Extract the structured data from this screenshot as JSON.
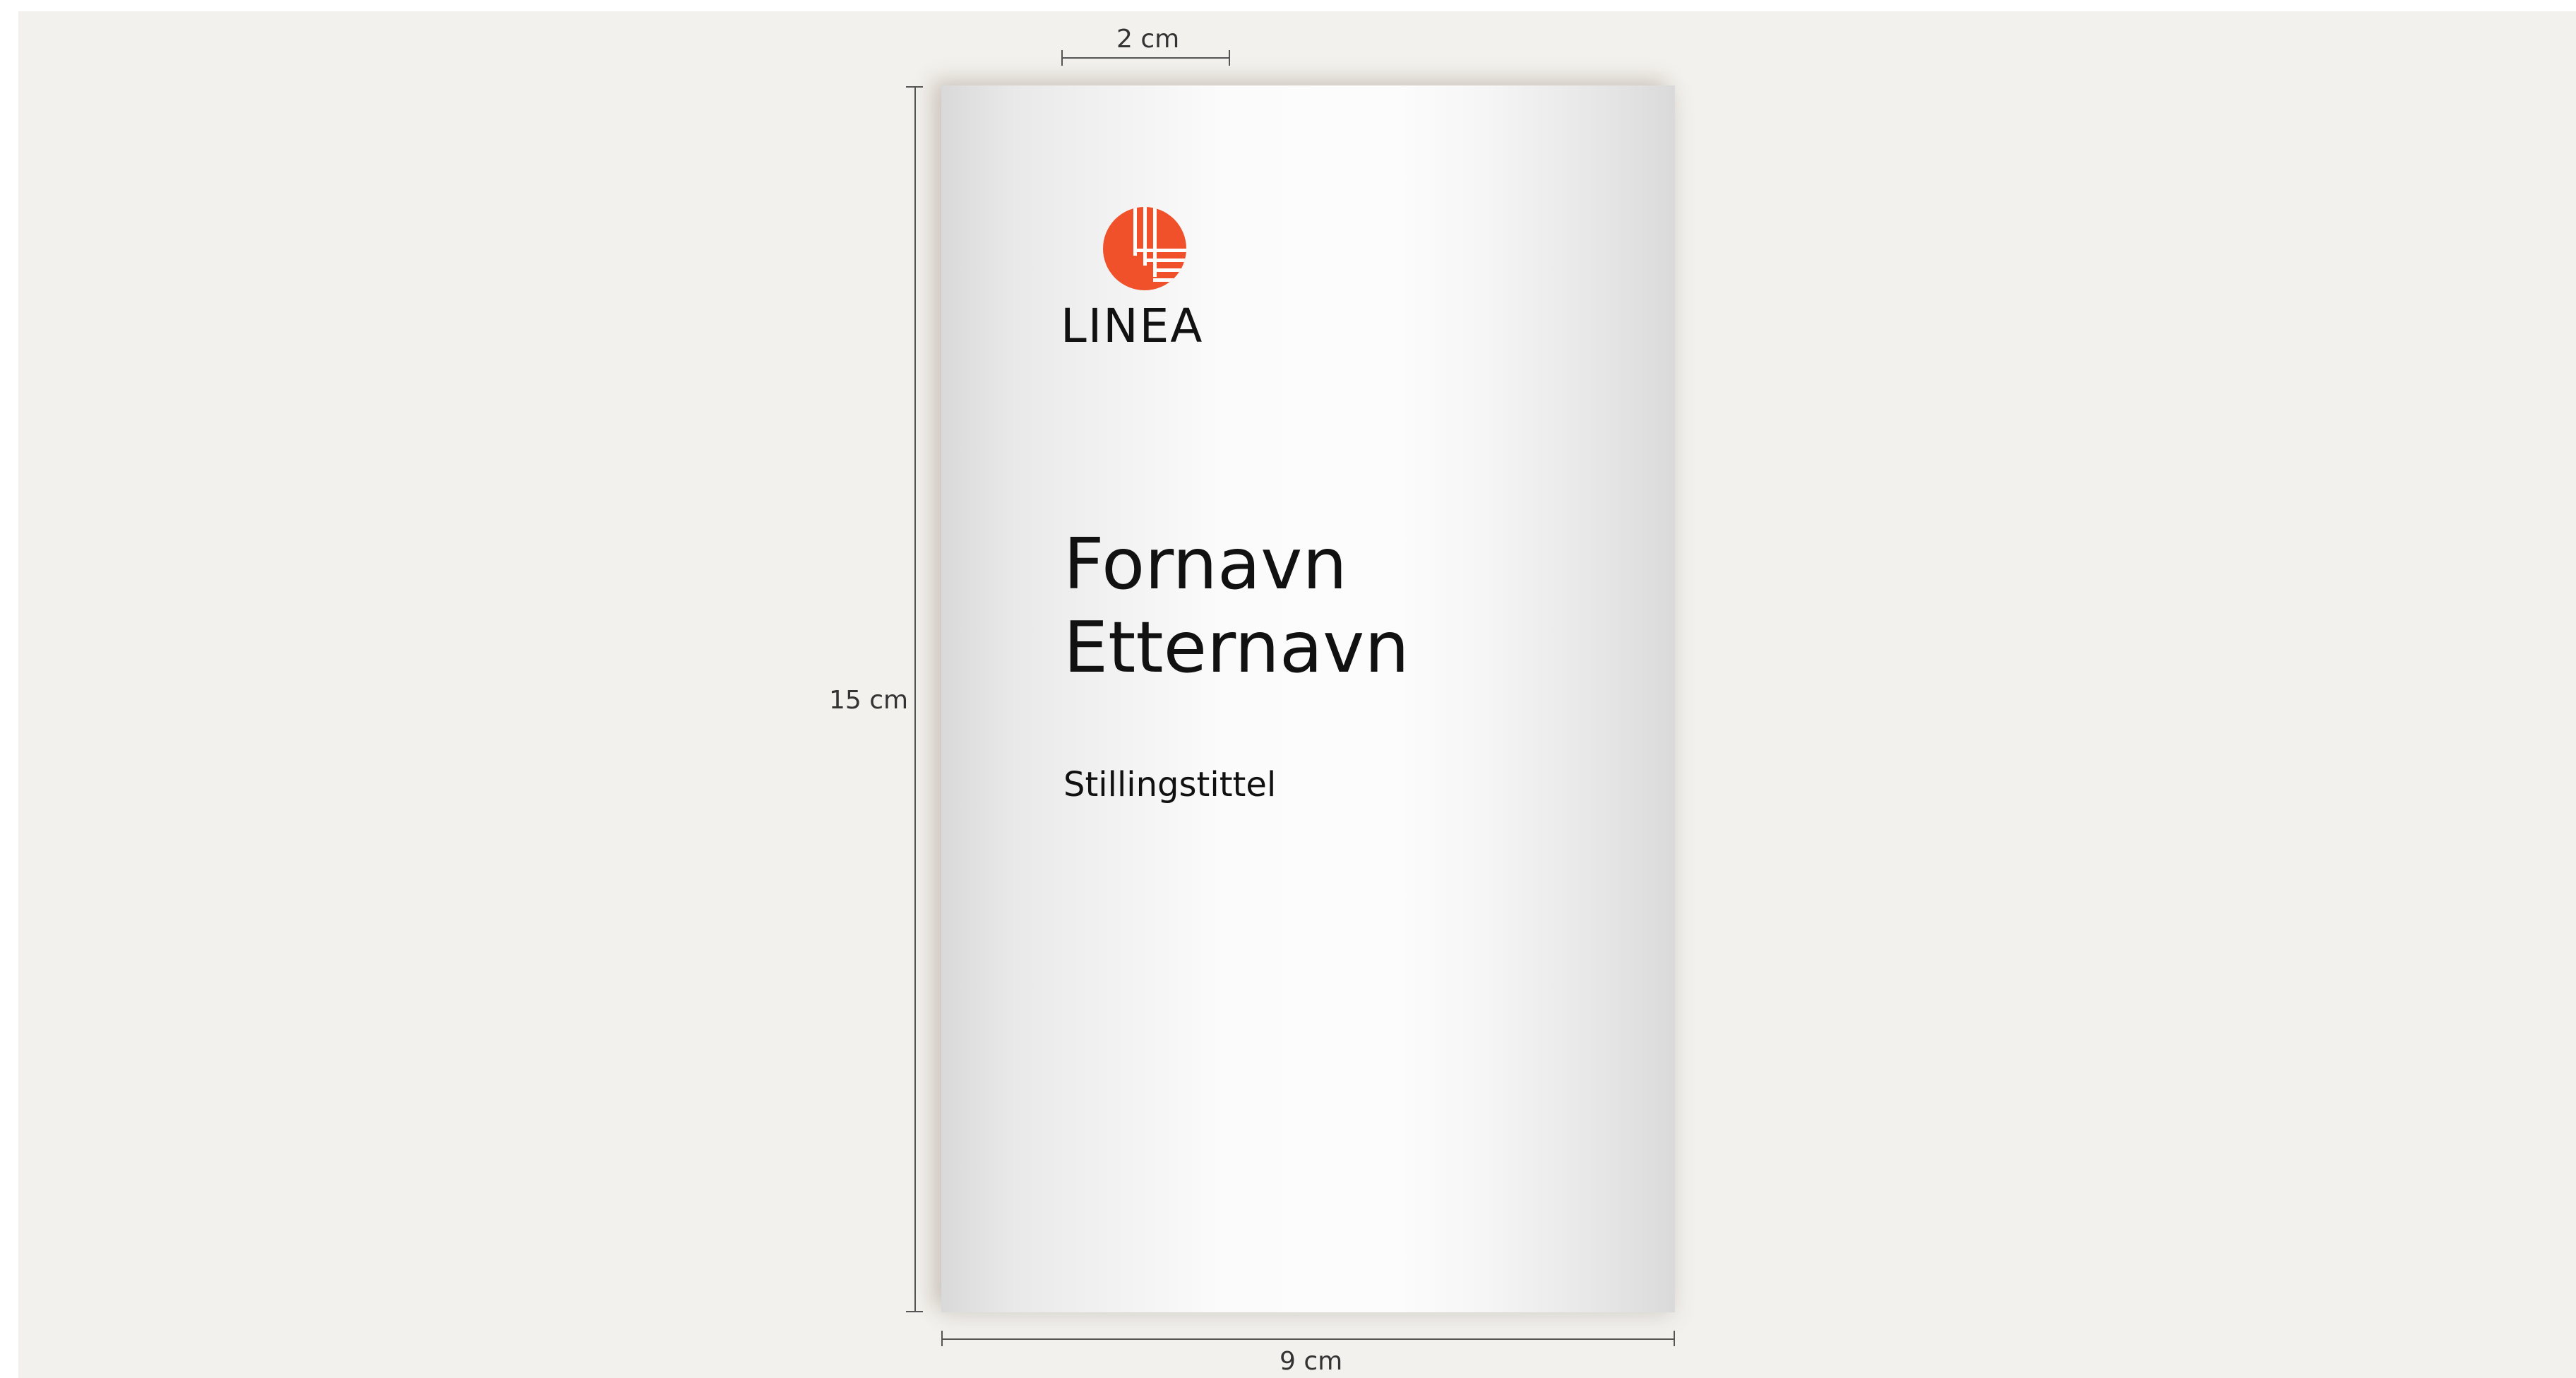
{
  "dimensions": {
    "width_label": "2 cm",
    "height_label": "15 cm",
    "bottom_label": "9 cm"
  },
  "logo": {
    "wordmark": "LINEA",
    "mark_icon": "linea-circle-grid-icon",
    "mark_color": "#f0502a"
  },
  "card": {
    "first_name": "Fornavn",
    "last_name": "Etternavn",
    "job_title": "Stillingstittel"
  },
  "colors": {
    "background": "#f3f1ed",
    "text": "#111111",
    "accent": "#f0502a"
  }
}
